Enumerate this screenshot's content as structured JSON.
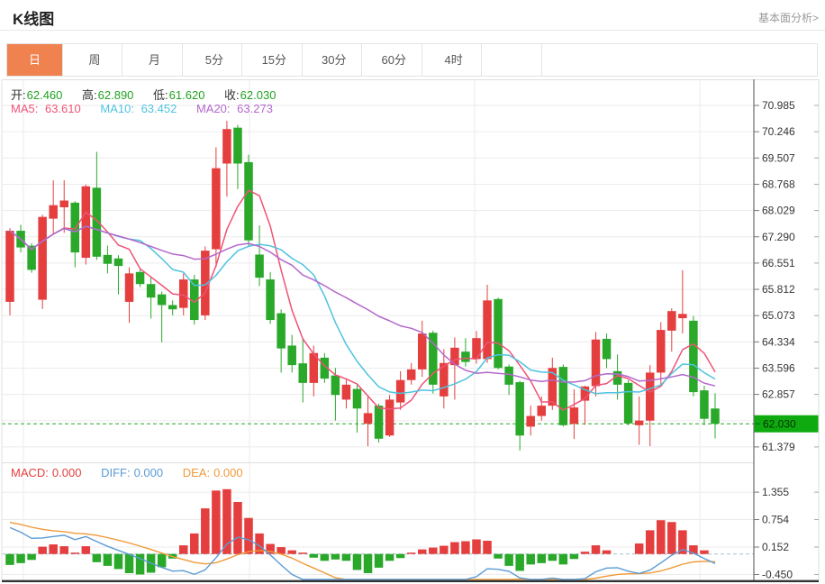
{
  "header": {
    "title": "K线图",
    "link": "基本面分析>"
  },
  "tabs": {
    "items": [
      "日",
      "周",
      "月",
      "5分",
      "15分",
      "30分",
      "60分",
      "4时"
    ],
    "active_index": 0
  },
  "readout": {
    "ohlc": [
      {
        "label": "开:",
        "value": "62.460"
      },
      {
        "label": "高:",
        "value": "62.890"
      },
      {
        "label": "低:",
        "value": "61.620"
      },
      {
        "label": "收:",
        "value": "62.030"
      }
    ],
    "ma": [
      {
        "label": "MA5:",
        "value": "63.610"
      },
      {
        "label": "MA10:",
        "value": "63.452"
      },
      {
        "label": "MA20:",
        "value": "63.273"
      }
    ],
    "macd": [
      {
        "label": "MACD:",
        "value": "0.000"
      },
      {
        "label": "DIFF:",
        "value": "0.000"
      },
      {
        "label": "DEA:",
        "value": "0.000"
      }
    ]
  },
  "axis": {
    "price_tick_labels": [
      "70.985",
      "70.246",
      "69.507",
      "68.768",
      "68.029",
      "67.290",
      "66.551",
      "65.812",
      "65.073",
      "64.334",
      "63.596",
      "62.857",
      "61.379"
    ],
    "unlabeled_gridlines": [
      62.118
    ],
    "macd_tick_labels": [
      "1.355",
      "0.754",
      "0.152",
      "-0.450"
    ],
    "last_price_tag": "62.030"
  },
  "chart_data": {
    "type": "candlestick",
    "title": "K线图 日K",
    "legend": [
      "MA5",
      "MA10",
      "MA20",
      "MACD",
      "DIFF",
      "DEA"
    ],
    "price_axis_range": [
      61.1,
      71.2
    ],
    "macd_axis_range": [
      -0.6,
      1.55
    ],
    "grid": true,
    "last_close": 62.03,
    "candles_ohlc": [
      [
        65.46,
        67.53,
        65.08,
        67.46
      ],
      [
        67.46,
        67.63,
        66.85,
        66.99
      ],
      [
        67.04,
        67.11,
        66.28,
        66.36
      ],
      [
        65.52,
        67.91,
        65.26,
        67.85
      ],
      [
        67.8,
        68.88,
        67.36,
        68.18
      ],
      [
        68.12,
        68.88,
        67.4,
        68.31
      ],
      [
        68.25,
        68.29,
        66.43,
        66.85
      ],
      [
        66.7,
        68.76,
        66.51,
        68.71
      ],
      [
        68.67,
        69.68,
        66.64,
        66.73
      ],
      [
        66.78,
        67.04,
        66.26,
        66.53
      ],
      [
        66.68,
        66.77,
        65.67,
        66.47
      ],
      [
        65.46,
        66.43,
        64.87,
        66.26
      ],
      [
        66.3,
        66.37,
        65.88,
        65.96
      ],
      [
        65.96,
        66.18,
        64.99,
        65.58
      ],
      [
        65.67,
        65.75,
        64.32,
        65.37
      ],
      [
        65.37,
        65.5,
        65.08,
        65.25
      ],
      [
        65.29,
        66.26,
        65.08,
        66.09
      ],
      [
        66.09,
        66.22,
        64.82,
        64.95
      ],
      [
        65.08,
        67.02,
        64.95,
        66.9
      ],
      [
        66.94,
        69.81,
        66.43,
        69.22
      ],
      [
        69.35,
        70.55,
        68.42,
        70.32
      ],
      [
        70.36,
        70.44,
        68.63,
        69.35
      ],
      [
        69.39,
        69.6,
        67.02,
        67.19
      ],
      [
        66.79,
        67.61,
        65.9,
        66.14
      ],
      [
        66.09,
        66.3,
        64.84,
        64.95
      ],
      [
        65.14,
        65.25,
        63.47,
        64.15
      ],
      [
        64.23,
        64.53,
        63.47,
        63.68
      ],
      [
        63.73,
        64.44,
        62.63,
        63.18
      ],
      [
        63.18,
        64.23,
        62.8,
        64.02
      ],
      [
        63.89,
        64.02,
        63.18,
        63.3
      ],
      [
        63.39,
        63.6,
        62.12,
        62.84
      ],
      [
        62.71,
        63.3,
        62.46,
        63.13
      ],
      [
        63.01,
        63.13,
        61.78,
        62.46
      ],
      [
        62.03,
        62.8,
        61.4,
        62.33
      ],
      [
        62.54,
        62.6,
        61.5,
        61.61
      ],
      [
        61.7,
        62.84,
        61.66,
        62.71
      ],
      [
        62.63,
        63.51,
        62.42,
        63.26
      ],
      [
        63.26,
        63.74,
        63.13,
        63.56
      ],
      [
        63.56,
        64.93,
        63.35,
        64.57
      ],
      [
        64.59,
        64.65,
        62.88,
        63.13
      ],
      [
        62.8,
        64.13,
        62.46,
        63.74
      ],
      [
        63.68,
        64.46,
        62.71,
        64.17
      ],
      [
        64.06,
        64.44,
        63.64,
        63.77
      ],
      [
        63.85,
        64.64,
        63.72,
        64.44
      ],
      [
        63.85,
        65.94,
        63.74,
        65.5
      ],
      [
        65.54,
        65.58,
        63.56,
        63.6
      ],
      [
        63.64,
        63.7,
        62.84,
        63.13
      ],
      [
        63.2,
        63.24,
        61.28,
        61.7
      ],
      [
        61.95,
        62.54,
        61.7,
        62.25
      ],
      [
        62.25,
        62.8,
        62.12,
        62.54
      ],
      [
        62.54,
        63.89,
        62.42,
        63.6
      ],
      [
        63.63,
        63.7,
        61.95,
        61.99
      ],
      [
        62.03,
        63.0,
        61.6,
        62.49
      ],
      [
        62.68,
        63.1,
        62.0,
        63.08
      ],
      [
        63.09,
        64.61,
        62.8,
        64.4
      ],
      [
        64.42,
        64.57,
        63.6,
        63.85
      ],
      [
        63.51,
        63.98,
        62.71,
        63.13
      ],
      [
        63.18,
        63.26,
        61.99,
        62.04
      ],
      [
        61.99,
        62.8,
        61.44,
        62.12
      ],
      [
        62.12,
        63.68,
        61.4,
        63.47
      ],
      [
        63.47,
        64.89,
        63.13,
        64.67
      ],
      [
        64.65,
        65.28,
        64.06,
        65.2
      ],
      [
        65.0,
        66.35,
        64.57,
        65.12
      ],
      [
        64.93,
        65.06,
        62.8,
        62.92
      ],
      [
        62.97,
        63.1,
        61.99,
        62.17
      ],
      [
        62.46,
        62.89,
        61.62,
        62.03
      ]
    ],
    "macd_histogram": [
      -0.24,
      -0.2,
      -0.13,
      0.16,
      0.21,
      0.17,
      0.03,
      0.17,
      -0.18,
      -0.26,
      -0.33,
      -0.42,
      -0.45,
      -0.41,
      -0.29,
      -0.1,
      0.19,
      0.45,
      1.0,
      1.39,
      1.42,
      1.14,
      0.79,
      0.45,
      0.22,
      0.15,
      0.08,
      0.03,
      -0.08,
      -0.15,
      -0.12,
      -0.15,
      -0.35,
      -0.42,
      -0.3,
      -0.15,
      -0.09,
      0.03,
      0.1,
      0.14,
      0.18,
      0.26,
      0.28,
      0.32,
      0.29,
      -0.1,
      -0.26,
      -0.37,
      -0.23,
      -0.2,
      -0.15,
      -0.23,
      -0.11,
      0.05,
      0.19,
      0.08,
      0.0,
      0.0,
      0.23,
      0.52,
      0.74,
      0.7,
      0.52,
      0.19,
      0.08,
      0.0
    ]
  },
  "colors": {
    "up_red": "#e53e3e",
    "down_green": "#2aa82a",
    "ma5": "#ef5377",
    "ma10": "#4ec3e0",
    "ma20": "#b468cc",
    "diff_line": "#5b9bd5",
    "dea_line": "#f09a38",
    "macd_label_red": "#e53e3e",
    "value_green": "#21a321",
    "tag_green": "#0faa0f",
    "tab_active_bg": "#f0824f",
    "grid": "#ebebeb",
    "axis": "#777777",
    "zero_dash": "#a8bfd0"
  }
}
